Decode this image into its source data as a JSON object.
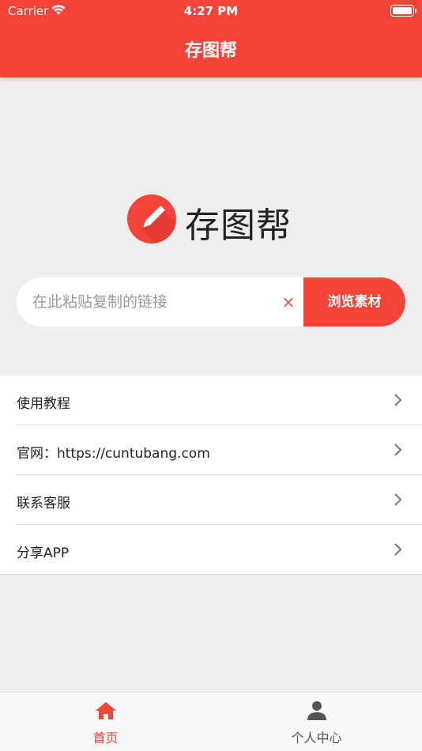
{
  "status_bar": {
    "carrier": "Carrier",
    "time": "4:27 PM"
  },
  "header": {
    "title": "存图帮"
  },
  "brand": {
    "name": "存图帮",
    "icon": "pencil-icon",
    "accent_color": "#f4443a"
  },
  "search": {
    "value": "",
    "placeholder": "在此粘贴复制的链接",
    "clear_symbol": "×",
    "browse_label": "浏览素材"
  },
  "menu": {
    "items": [
      {
        "label": "使用教程"
      },
      {
        "label": "官网：https://cuntubang.com"
      },
      {
        "label": "联系客服"
      },
      {
        "label": "分享APP"
      }
    ]
  },
  "tabbar": {
    "tabs": [
      {
        "label": "首页",
        "icon": "home-icon",
        "active": true
      },
      {
        "label": "个人中心",
        "icon": "person-icon",
        "active": false
      }
    ]
  }
}
